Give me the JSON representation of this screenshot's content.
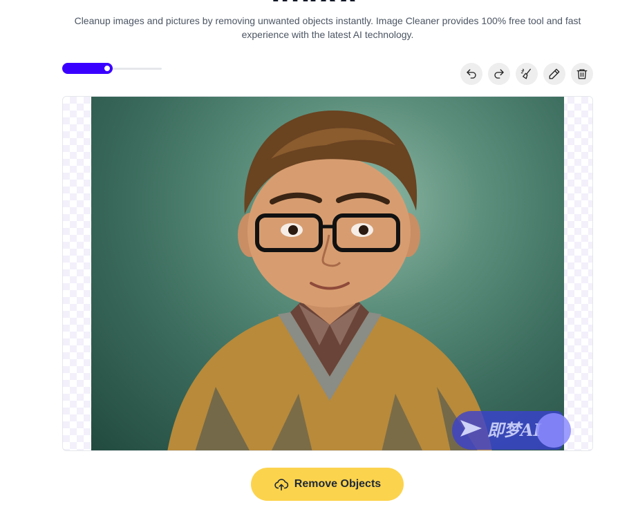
{
  "header": {
    "subtitle": "Cleanup images and pictures by removing unwanted objects instantly. Image Cleaner provides 100% free tool and fast experience with the latest AI technology."
  },
  "brush": {
    "icon": "brush-size-slider",
    "level": 0.45,
    "color": "#3a00ff"
  },
  "toolbar": {
    "tools": [
      {
        "name": "undo-icon"
      },
      {
        "name": "redo-icon"
      },
      {
        "name": "erase-brush-icon"
      },
      {
        "name": "pencil-icon"
      },
      {
        "name": "trash-icon"
      }
    ]
  },
  "canvas": {
    "watermark_text": "即梦AI"
  },
  "actions": {
    "remove_label": "Remove Objects",
    "remove_icon": "cloud-upload-icon",
    "color": "#fcd34d"
  }
}
